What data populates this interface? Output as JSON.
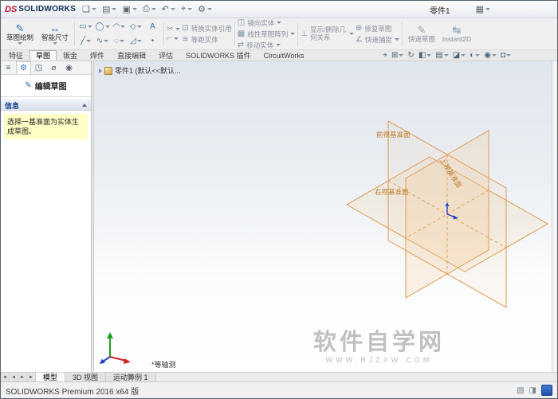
{
  "colors": {
    "plane_stroke": "#dd9a4e",
    "plane_fill": "#f4c48a",
    "message_bg": "#ffffc6",
    "viewport_top": "#e0e6ed",
    "accent_blue": "#2f6fb2",
    "origin_blue": "#2244cc"
  },
  "icons": {
    "new": "❏",
    "open": "▤",
    "save": "▣",
    "print": "⎙",
    "undo": "↶",
    "select": "⌖",
    "options": "⚙",
    "apps_grid": "▦",
    "pencil": "✎",
    "dimension": "↔",
    "tools_row1": [
      "▭",
      "◯",
      "◠",
      "◇",
      "A"
    ],
    "tools_row2": [
      "╱",
      "∿",
      "◌",
      "◿",
      "•"
    ],
    "trim": "✂",
    "extend": "⌐",
    "convert": "⊡",
    "offset": "≋",
    "mirror": "◫",
    "pattern": "▦",
    "move": "⇄",
    "relations": "⊥",
    "repair": "⊕",
    "snaps": "∠",
    "instant2d_icon": "↹",
    "hud": [
      "⌖",
      "⊞",
      "↻",
      "◧",
      "▤",
      "◪",
      "◐",
      "◉",
      "◘"
    ],
    "panel_tabs": [
      "≡",
      "⚙",
      "◳",
      "⌀",
      "◉"
    ],
    "nav": [
      "◄",
      "◄",
      "►",
      "►"
    ],
    "status": [
      "▧",
      "◨"
    ]
  },
  "title_bar": {
    "logo_text": "DS",
    "app_name": "SOLIDWORKS",
    "document_title": "零件1"
  },
  "ribbon": {
    "sketch": "草图绘制",
    "smart_dimension": "智能尺寸",
    "convert_entities": "转换实体引用",
    "offset_entities": "等距实体",
    "mirror_entities": "镜向实体",
    "linear_pattern": "线性草图阵列",
    "move_entities": "移动实体",
    "display_relations": "显示/删除几何关系",
    "repair_sketch": "修复草图",
    "quick_snaps": "快速捕捉",
    "rapid_sketch": "快速草图",
    "instant2d": "Instant2D"
  },
  "command_tabs": {
    "items": [
      {
        "label": "特征"
      },
      {
        "label": "草图"
      },
      {
        "label": "钣金"
      },
      {
        "label": "焊件"
      },
      {
        "label": "直接编辑"
      },
      {
        "label": "评估"
      },
      {
        "label": "SOLIDWORKS 插件"
      },
      {
        "label": "CircuitWorks"
      }
    ],
    "active_index": 1
  },
  "panel": {
    "header": "编辑草图",
    "info_title": "信息",
    "message": "选择一基准面为实体生成草图。"
  },
  "feature_tree": {
    "root_label": "零件1 (默认<<默认..."
  },
  "viewport": {
    "planes": {
      "front": "前视基准面",
      "top": "上视基准面",
      "right": "右视基准面"
    },
    "view_label": "*等轴测",
    "watermark": {
      "line1": "软件自学网",
      "line2": "www.rjzxw.com"
    }
  },
  "bottom_bar": {
    "tabs": [
      {
        "label": "模型"
      },
      {
        "label": "3D 视图"
      },
      {
        "label": "运动算例 1"
      }
    ],
    "active_index": 0
  },
  "status_bar": {
    "text": "SOLIDWORKS Premium 2016 x64 版"
  }
}
